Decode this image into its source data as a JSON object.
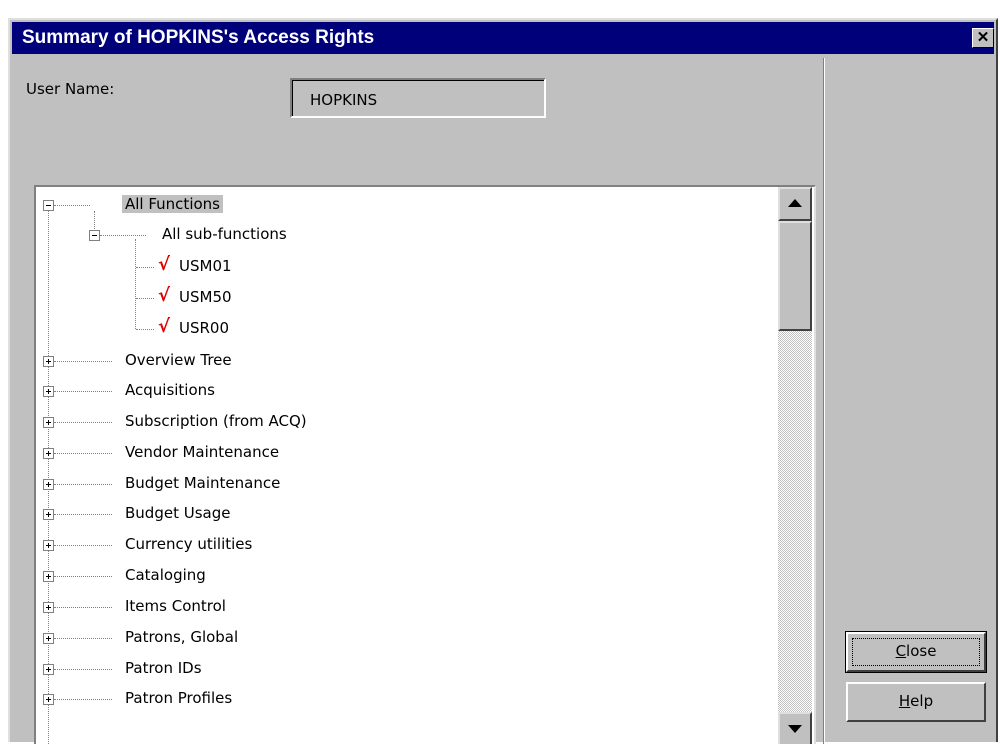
{
  "window": {
    "title": "Summary of HOPKINS's Access Rights",
    "close_glyph": "✕"
  },
  "user": {
    "label": "User Name:",
    "value": "HOPKINS"
  },
  "tree": {
    "root": {
      "label": "All Functions",
      "expanded": true
    },
    "sub": {
      "label": "All sub-functions",
      "expanded": true
    },
    "checked_items": [
      "USM01",
      "USM50",
      "USR00"
    ],
    "check_glyph": "√",
    "collapsed_items": [
      "Overview Tree",
      "Acquisitions",
      "Subscription (from ACQ)",
      "Vendor Maintenance",
      "Budget Maintenance",
      "Budget Usage",
      "Currency utilities",
      "Cataloging",
      "Items Control",
      "Patrons, Global",
      "Patron IDs",
      "Patron Profiles"
    ]
  },
  "buttons": {
    "close": {
      "prefix": "",
      "mnemonic": "C",
      "rest": "lose"
    },
    "help": {
      "prefix": "",
      "mnemonic": "H",
      "rest": "elp"
    }
  },
  "colors": {
    "title_bar": "#00007b",
    "dialog_face": "#c0c0c0",
    "check_mark": "#e00000"
  }
}
